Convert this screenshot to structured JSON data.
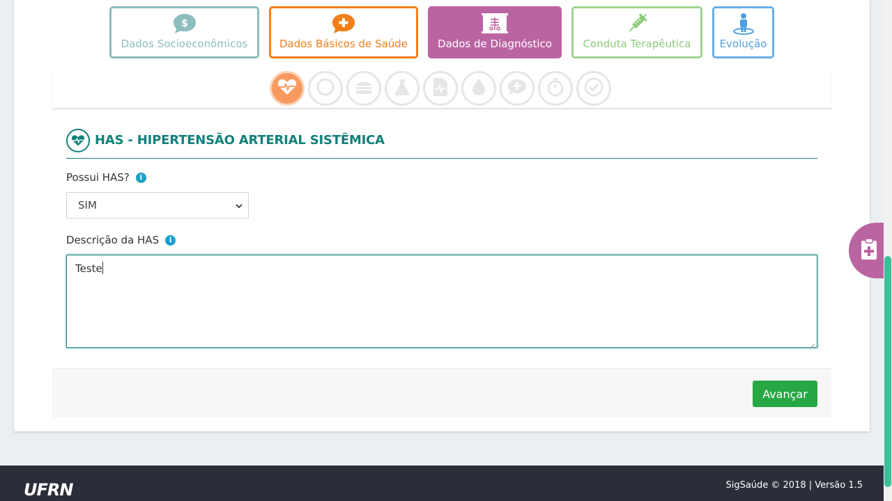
{
  "categories": [
    {
      "label": "Dados Socioeconômicos",
      "icon": "dollar-chat-icon",
      "color": "#8dbdbd"
    },
    {
      "label": "Dados Básicos de Saúde",
      "icon": "plus-chat-icon",
      "color": "#f07f1b"
    },
    {
      "label": "Dados de Diagnóstico",
      "icon": "xray-board-icon",
      "color": "#bb64a2",
      "active": true
    },
    {
      "label": "Conduta Terapêutica",
      "icon": "syringe-icon",
      "color": "#8fcb7d"
    },
    {
      "label": "Evolução",
      "icon": "person-target-icon",
      "color": "#4f9fdf"
    }
  ],
  "steps": [
    {
      "icon": "heartbeat-icon",
      "active": true
    },
    {
      "icon": "circle-icon"
    },
    {
      "icon": "burger-icon"
    },
    {
      "icon": "flask-icon"
    },
    {
      "icon": "file-pulse-icon"
    },
    {
      "icon": "drop-icon"
    },
    {
      "icon": "plus-comment-icon"
    },
    {
      "icon": "stopwatch-icon"
    },
    {
      "icon": "check-icon"
    }
  ],
  "section": {
    "title": "HAS - HIPERTENSÃO ARTERIAL SISTÊMICA"
  },
  "fields": {
    "has_label": "Possui HAS?",
    "has_value": "SIM",
    "desc_label": "Descrição da HAS",
    "desc_value": "Teste"
  },
  "actions": {
    "next_label": "Avançar"
  },
  "footer": {
    "logo_text": "UFRN",
    "copyright": "SigSaúde © 2018 | Versão 1.5"
  },
  "colors": {
    "primary": "#12807a",
    "accent_orange": "#f89a60",
    "success": "#28a745",
    "purple": "#bb64a2"
  }
}
